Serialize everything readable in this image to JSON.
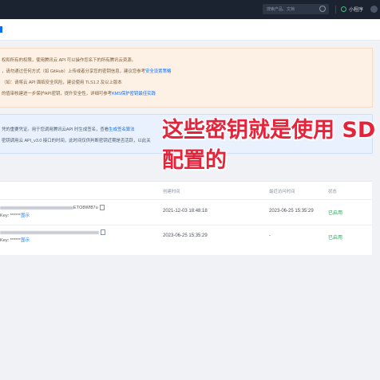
{
  "topbar": {
    "search_placeholder": "搜索产品、文档",
    "mini_program_label": "小程序"
  },
  "notice_warning": {
    "lines": [
      {
        "text": "权和所有的权限，使用腾讯云 API 可以操作您名下的所有腾讯云资源。",
        "link": ""
      },
      {
        "text": "，请勿通过任何方式（如 GitHub）上传或者分享您的密钥信息，建议您参考",
        "link": "安全设置策略"
      },
      {
        "text": "（如：请将云 API 面临安全风险，建议使用 TLS1.2 及以上版本",
        "link": ""
      },
      {
        "text": "的值审核建进一步保护API密钥，提升安全性，详细可参考",
        "link": "KMS保护密钥最佳实践"
      }
    ]
  },
  "notice_info": {
    "lines": [
      {
        "text": "凭的重要凭证。用于您调用腾讯云API 时生成签名，查看",
        "link": "生成签名算法"
      },
      {
        "text": "密钥调用云 API_v3.0 接口的时间，此时间仅供判断密钥近期是否活跃，以此关",
        "link": ""
      }
    ]
  },
  "overlay": {
    "line1": "这些密钥就是使用 SD",
    "line2": "配置的"
  },
  "table": {
    "headers": {
      "created": "创建时间",
      "last_access": "最近访问时间",
      "status": "状态"
    },
    "rows": [
      {
        "secret_id_tail": "ETO8Wf87u",
        "secret_key_label": "Key: ******",
        "show_label": "显示",
        "created": "2021-12-03 18:48:18",
        "last_access": "2023-06-25 15:35:29",
        "status": "已启用"
      },
      {
        "secret_id_tail": "",
        "secret_key_label": "Key: ******",
        "show_label": "显示",
        "created": "2023-06-25 15:35:29",
        "last_access": "-",
        "status": "已启用"
      }
    ]
  },
  "colors": {
    "topbar": "#1b2330",
    "warning_bg": "#fdf1e6",
    "info_bg": "#e8f1fd",
    "overlay_red": "#e5243b",
    "link_blue": "#0a6cff",
    "status_green": "#29a35a"
  }
}
